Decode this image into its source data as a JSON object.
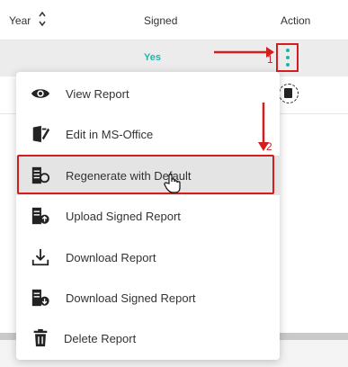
{
  "header": {
    "year_label": "Year",
    "signed_label": "Signed",
    "action_label": "Action"
  },
  "rows": [
    {
      "signed": "Yes"
    }
  ],
  "menu": {
    "items": [
      {
        "label": "View Report",
        "icon": "eye-icon"
      },
      {
        "label": "Edit in MS-Office",
        "icon": "edit-document-icon"
      },
      {
        "label": "Regenerate with Default",
        "icon": "regenerate-icon",
        "highlighted": true
      },
      {
        "label": "Upload Signed Report",
        "icon": "upload-report-icon"
      },
      {
        "label": "Download Report",
        "icon": "download-icon"
      },
      {
        "label": "Download Signed Report",
        "icon": "download-signed-icon"
      },
      {
        "label": "Delete Report",
        "icon": "trash-icon"
      }
    ]
  },
  "annotations": {
    "step1": "1",
    "step2": "2",
    "color": "#d21e1e"
  },
  "colors": {
    "accent": "#1fb7a8"
  }
}
